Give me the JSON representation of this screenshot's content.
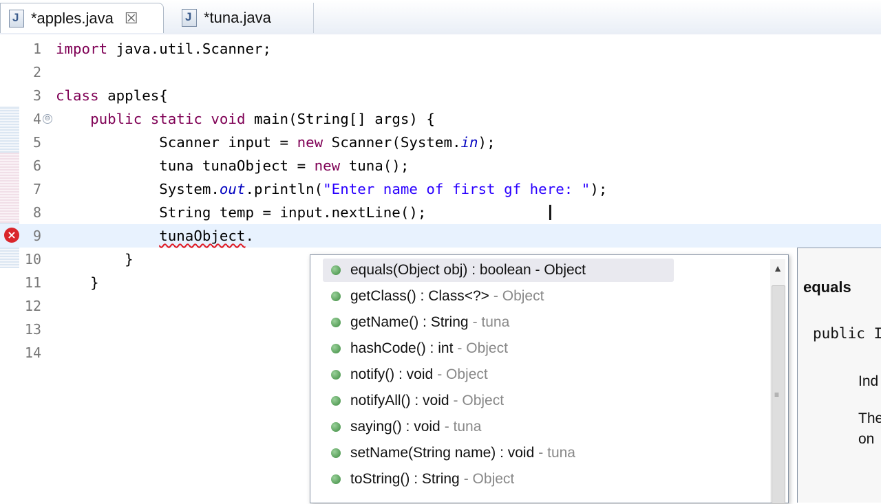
{
  "tabs": [
    {
      "label": "*apples.java",
      "active": true,
      "close_glyph": "☒"
    },
    {
      "label": "*tuna.java",
      "active": false
    }
  ],
  "editor": {
    "lines": [
      {
        "num": "1",
        "parts": [
          [
            "kw",
            "import"
          ],
          [
            "t",
            " java.util.Scanner;"
          ]
        ]
      },
      {
        "num": "2",
        "parts": []
      },
      {
        "num": "3",
        "parts": [
          [
            "kw",
            "class"
          ],
          [
            "t",
            " apples{"
          ]
        ]
      },
      {
        "num": "4",
        "parts": [
          [
            "t",
            "    "
          ],
          [
            "kw",
            "public static void"
          ],
          [
            "t",
            " main(String[] args) {"
          ]
        ]
      },
      {
        "num": "5",
        "parts": [
          [
            "t",
            "            Scanner input = "
          ],
          [
            "kw",
            "new"
          ],
          [
            "t",
            " Scanner(System."
          ],
          [
            "fld",
            "in"
          ],
          [
            "t",
            ");"
          ]
        ]
      },
      {
        "num": "6",
        "parts": [
          [
            "t",
            "            tuna tunaObject = "
          ],
          [
            "kw",
            "new"
          ],
          [
            "t",
            " tuna();"
          ]
        ]
      },
      {
        "num": "7",
        "parts": [
          [
            "t",
            "            System."
          ],
          [
            "fld",
            "out"
          ],
          [
            "t",
            ".println("
          ],
          [
            "str",
            "\"Enter name of first gf here: \""
          ],
          [
            "t",
            ");"
          ]
        ]
      },
      {
        "num": "8",
        "parts": [
          [
            "t",
            "            String temp = input.nextLine();"
          ]
        ]
      },
      {
        "num": "9",
        "parts": [
          [
            "t",
            "            "
          ],
          [
            "err",
            "tunaObject"
          ],
          [
            "t",
            "."
          ]
        ]
      },
      {
        "num": "10",
        "parts": [
          [
            "t",
            "        }"
          ]
        ]
      },
      {
        "num": "11",
        "parts": [
          [
            "t",
            "    }"
          ]
        ]
      },
      {
        "num": "12",
        "parts": []
      },
      {
        "num": "13",
        "parts": []
      },
      {
        "num": "14",
        "parts": []
      }
    ],
    "fold_glyph": "⊖",
    "error_glyph": "×",
    "cursor_glyph": "I"
  },
  "content_assist": {
    "proposals": [
      {
        "sig": "equals(Object obj) : boolean - Object",
        "decl": "",
        "selected": true
      },
      {
        "sig": "getClass() : Class<?>",
        "decl": "- Object"
      },
      {
        "sig": "getName() : String",
        "decl": "- tuna"
      },
      {
        "sig": "hashCode() : int",
        "decl": "- Object"
      },
      {
        "sig": "notify() : void",
        "decl": "- Object"
      },
      {
        "sig": "notifyAll() : void",
        "decl": "- Object"
      },
      {
        "sig": "saying() : void",
        "decl": "- tuna"
      },
      {
        "sig": "setName(String name) : void",
        "decl": "- tuna"
      },
      {
        "sig": "toString() : String",
        "decl": "- Object"
      }
    ],
    "scroll_up_glyph": "▲",
    "grip_glyph": "≡"
  },
  "javadoc": {
    "title": "equals",
    "signature": "public I",
    "text1": "Ind",
    "text2": "The",
    "text3": "on"
  }
}
